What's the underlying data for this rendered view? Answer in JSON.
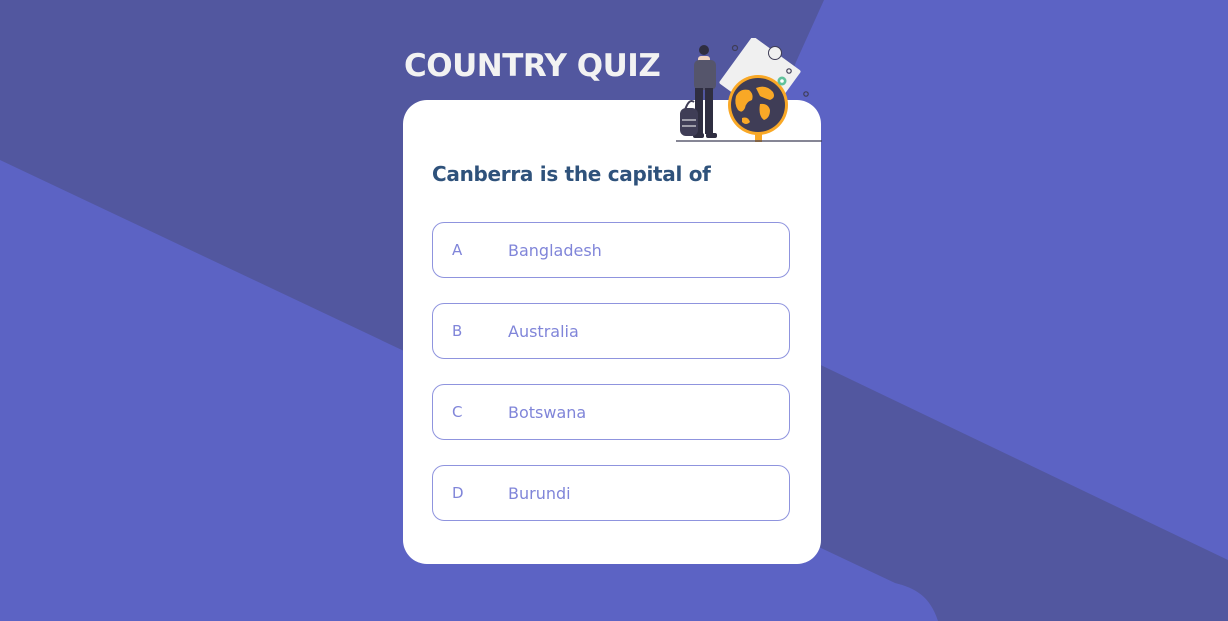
{
  "app": {
    "title": "COUNTRY QUIZ"
  },
  "quiz": {
    "question": "Canberra is the capital of",
    "options": [
      {
        "letter": "A",
        "text": "Bangladesh"
      },
      {
        "letter": "B",
        "text": "Australia"
      },
      {
        "letter": "C",
        "text": "Botswana"
      },
      {
        "letter": "D",
        "text": "Burundi"
      }
    ]
  },
  "icons": {
    "illustration": "traveler-with-globe-icon"
  },
  "colors": {
    "background": "#5c63c4",
    "background_dark": "#52579f",
    "card": "#ffffff",
    "question": "#2f527b",
    "option_accent": "#6066d0",
    "title": "#f2f2f2",
    "globe_land": "#f9a826"
  }
}
